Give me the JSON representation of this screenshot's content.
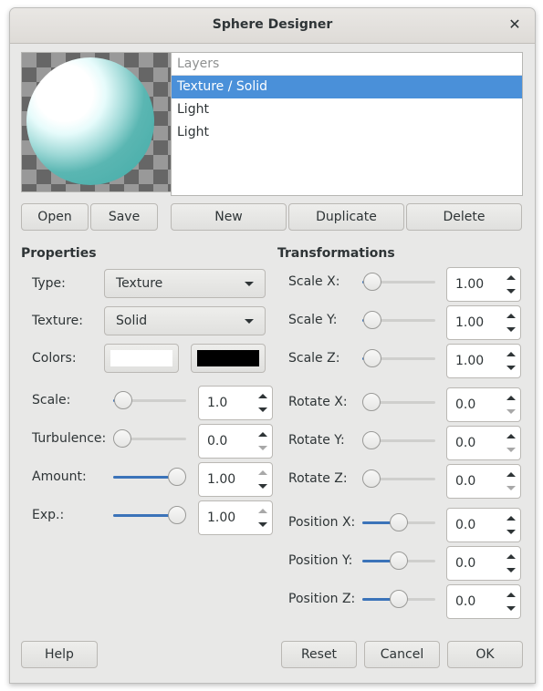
{
  "window": {
    "title": "Sphere Designer",
    "close_icon": "close-icon"
  },
  "preview": {
    "icon": "sphere-preview",
    "sphere_color": "#4fb1ad"
  },
  "layers": {
    "header": "Layers",
    "items": [
      {
        "label": "Texture / Solid",
        "selected": true
      },
      {
        "label": "Light",
        "selected": false
      },
      {
        "label": "Light",
        "selected": false
      }
    ]
  },
  "file_buttons": {
    "open": "Open",
    "save": "Save"
  },
  "layer_buttons": {
    "new": "New",
    "duplicate": "Duplicate",
    "delete": "Delete"
  },
  "properties": {
    "title": "Properties",
    "type": {
      "label": "Type:",
      "value": "Texture"
    },
    "texture": {
      "label": "Texture:",
      "value": "Solid"
    },
    "colors": {
      "label": "Colors:",
      "color1": "#ffffff",
      "color2": "#000000"
    },
    "scale": {
      "label": "Scale:",
      "value": "1.0",
      "fraction": 0.02,
      "up_enabled": true,
      "down_enabled": true
    },
    "turbulence": {
      "label": "Turbulence:",
      "value": "0.0",
      "fraction": 0.0,
      "up_enabled": true,
      "down_enabled": false
    },
    "amount": {
      "label": "Amount:",
      "value": "1.00",
      "fraction": 1.0,
      "up_enabled": false,
      "down_enabled": true
    },
    "exp": {
      "label": "Exp.:",
      "value": "1.00",
      "fraction": 1.0,
      "up_enabled": false,
      "down_enabled": true
    }
  },
  "transformations": {
    "title": "Transformations",
    "scale_x": {
      "label": "Scale X:",
      "value": "1.00",
      "fraction": 0.02
    },
    "scale_y": {
      "label": "Scale Y:",
      "value": "1.00",
      "fraction": 0.02
    },
    "scale_z": {
      "label": "Scale Z:",
      "value": "1.00",
      "fraction": 0.02
    },
    "rotate_x": {
      "label": "Rotate X:",
      "value": "0.0",
      "fraction": 0.0
    },
    "rotate_y": {
      "label": "Rotate Y:",
      "value": "0.0",
      "fraction": 0.0
    },
    "rotate_z": {
      "label": "Rotate Z:",
      "value": "0.0",
      "fraction": 0.0
    },
    "position_x": {
      "label": "Position X:",
      "value": "0.0",
      "fraction": 0.5
    },
    "position_y": {
      "label": "Position Y:",
      "value": "0.0",
      "fraction": 0.5
    },
    "position_z": {
      "label": "Position Z:",
      "value": "0.0",
      "fraction": 0.5
    }
  },
  "dialog_buttons": {
    "help": "Help",
    "reset": "Reset",
    "cancel": "Cancel",
    "ok": "OK"
  }
}
